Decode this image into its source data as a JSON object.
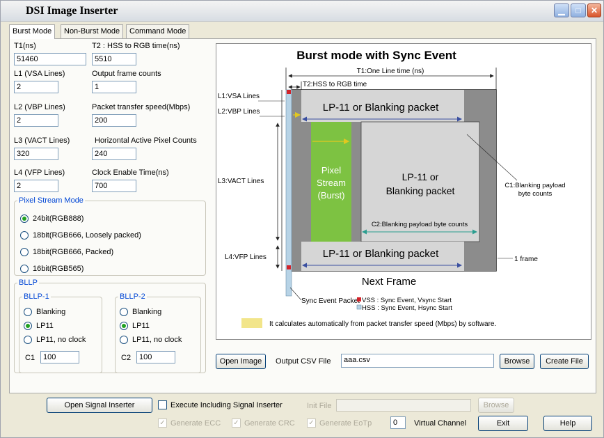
{
  "window": {
    "title": "DSI Image Inserter"
  },
  "tabs": [
    "Burst Mode",
    "Non-Burst Mode",
    "Command Mode"
  ],
  "fields": {
    "t1": {
      "label": "T1(ns)",
      "value": "51460"
    },
    "t2": {
      "label": "T2 : HSS to RGB time(ns)",
      "value": "5510"
    },
    "l1": {
      "label": "L1 (VSA Lines)",
      "value": "2"
    },
    "ofc": {
      "label": "Output frame counts",
      "value": "1"
    },
    "l2": {
      "label": "L2 (VBP Lines)",
      "value": "2"
    },
    "pts": {
      "label": "Packet transfer speed(Mbps)",
      "value": "200"
    },
    "l3": {
      "label": "L3 (VACT Lines)",
      "value": "320"
    },
    "hapc": {
      "label": "Horizontal Active Pixel Counts",
      "value": "240"
    },
    "l4": {
      "label": "L4 (VFP Lines)",
      "value": "2"
    },
    "cet": {
      "label": "Clock Enable Time(ns)",
      "value": "700"
    }
  },
  "pixel_stream_mode": {
    "legend": "Pixel Stream Mode",
    "options": [
      "24bit(RGB888)",
      "18bit(RGB666, Loosely packed)",
      "18bit(RGB666, Packed)",
      "16bit(RGB565)"
    ],
    "selected": 0
  },
  "bllp": {
    "legend": "BLLP",
    "bllp1": {
      "legend": "BLLP-1",
      "options": [
        "Blanking",
        "LP11",
        "LP11, no clock"
      ],
      "selected": 1,
      "c_label": "C1",
      "c_value": "100"
    },
    "bllp2": {
      "legend": "BLLP-2",
      "options": [
        "Blanking",
        "LP11",
        "LP11, no clock"
      ],
      "selected": 1,
      "c_label": "C2",
      "c_value": "100"
    }
  },
  "diagram": {
    "title": "Burst mode with Sync Event",
    "t1_label": "T1:One Line time (ns)",
    "t2_label": "T2:HSS to RGB time",
    "l1_label": "L1:VSA Lines",
    "l2_label": "L2:VBP Lines",
    "l3_label": "L3:VACT Lines",
    "l4_label": "L4:VFP Lines",
    "top_packet": "LP-11 or Blanking packet",
    "pixel_stream": [
      "Pixel",
      "Stream",
      "(Burst)"
    ],
    "mid_packet": [
      "LP-11 or",
      "Blanking packet"
    ],
    "c2_label": "C2:Blanking payload byte counts",
    "c1_label": [
      "C1:Blanking payload",
      "byte counts"
    ],
    "bottom_packet": "LP-11 or Blanking packet",
    "frame_label": "1 frame",
    "next_frame": "Next Frame",
    "sync_label": "Sync Event Packet",
    "vss_label": "VSS : Sync Event, Vsync Start",
    "hss_label": "HSS : Sync Event, Hsync Start",
    "note": "It calculates automatically from packet transfer speed (Mbps) by software.",
    "colors": {
      "green": "#7dc242",
      "gray": "#8c8c8c",
      "light": "#d6d6d6",
      "yellow": "#f7e64a",
      "red": "#d2232a"
    }
  },
  "file_row": {
    "open_image": "Open Image",
    "csv_label": "Output CSV File",
    "csv_value": "aaa.csv",
    "browse": "Browse",
    "create_file": "Create File"
  },
  "bottom": {
    "open_signal_inserter": "Open Signal Inserter",
    "execute_label": "Execute Including Signal Inserter",
    "init_file_label": "Init File",
    "init_file_value": "",
    "browse": "Browse",
    "gen_ecc": "Generate ECC",
    "gen_crc": "Generate CRC",
    "gen_eotp": "Generate EoTp",
    "vc_value": "0",
    "vc_label": "Virtual Channel",
    "exit": "Exit",
    "help": "Help"
  }
}
